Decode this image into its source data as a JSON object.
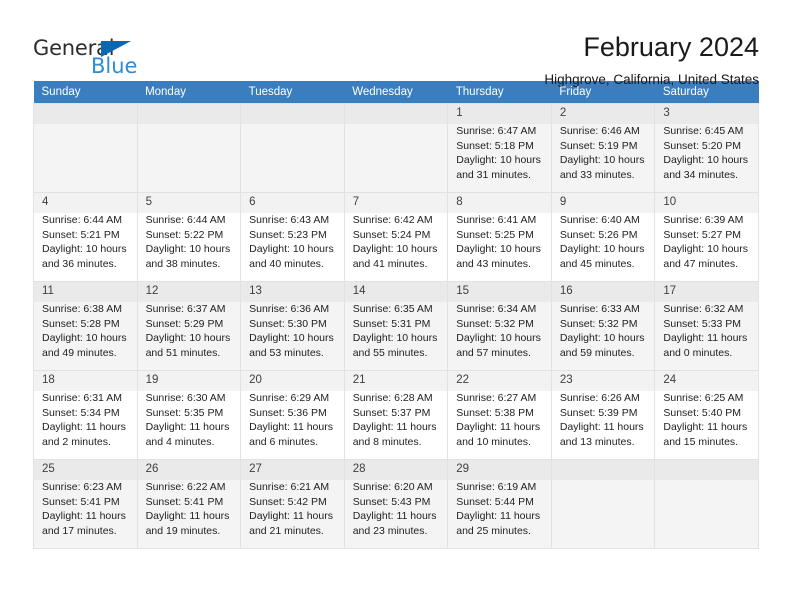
{
  "brand": {
    "name_top": "General",
    "name_bottom": "Blue",
    "triangle_color": "#0b67b2",
    "blue_text_color": "#2e8bd8"
  },
  "header": {
    "month_title": "February 2024",
    "location": "Highgrove, California, United States"
  },
  "calendar": {
    "header_background": "#3a7ebf",
    "weekdays": [
      "Sunday",
      "Monday",
      "Tuesday",
      "Wednesday",
      "Thursday",
      "Friday",
      "Saturday"
    ],
    "weeks": [
      [
        {
          "day": "",
          "sunrise": "",
          "sunset": "",
          "daylight": ""
        },
        {
          "day": "",
          "sunrise": "",
          "sunset": "",
          "daylight": ""
        },
        {
          "day": "",
          "sunrise": "",
          "sunset": "",
          "daylight": ""
        },
        {
          "day": "",
          "sunrise": "",
          "sunset": "",
          "daylight": ""
        },
        {
          "day": "1",
          "sunrise": "Sunrise: 6:47 AM",
          "sunset": "Sunset: 5:18 PM",
          "daylight": "Daylight: 10 hours and 31 minutes."
        },
        {
          "day": "2",
          "sunrise": "Sunrise: 6:46 AM",
          "sunset": "Sunset: 5:19 PM",
          "daylight": "Daylight: 10 hours and 33 minutes."
        },
        {
          "day": "3",
          "sunrise": "Sunrise: 6:45 AM",
          "sunset": "Sunset: 5:20 PM",
          "daylight": "Daylight: 10 hours and 34 minutes."
        }
      ],
      [
        {
          "day": "4",
          "sunrise": "Sunrise: 6:44 AM",
          "sunset": "Sunset: 5:21 PM",
          "daylight": "Daylight: 10 hours and 36 minutes."
        },
        {
          "day": "5",
          "sunrise": "Sunrise: 6:44 AM",
          "sunset": "Sunset: 5:22 PM",
          "daylight": "Daylight: 10 hours and 38 minutes."
        },
        {
          "day": "6",
          "sunrise": "Sunrise: 6:43 AM",
          "sunset": "Sunset: 5:23 PM",
          "daylight": "Daylight: 10 hours and 40 minutes."
        },
        {
          "day": "7",
          "sunrise": "Sunrise: 6:42 AM",
          "sunset": "Sunset: 5:24 PM",
          "daylight": "Daylight: 10 hours and 41 minutes."
        },
        {
          "day": "8",
          "sunrise": "Sunrise: 6:41 AM",
          "sunset": "Sunset: 5:25 PM",
          "daylight": "Daylight: 10 hours and 43 minutes."
        },
        {
          "day": "9",
          "sunrise": "Sunrise: 6:40 AM",
          "sunset": "Sunset: 5:26 PM",
          "daylight": "Daylight: 10 hours and 45 minutes."
        },
        {
          "day": "10",
          "sunrise": "Sunrise: 6:39 AM",
          "sunset": "Sunset: 5:27 PM",
          "daylight": "Daylight: 10 hours and 47 minutes."
        }
      ],
      [
        {
          "day": "11",
          "sunrise": "Sunrise: 6:38 AM",
          "sunset": "Sunset: 5:28 PM",
          "daylight": "Daylight: 10 hours and 49 minutes."
        },
        {
          "day": "12",
          "sunrise": "Sunrise: 6:37 AM",
          "sunset": "Sunset: 5:29 PM",
          "daylight": "Daylight: 10 hours and 51 minutes."
        },
        {
          "day": "13",
          "sunrise": "Sunrise: 6:36 AM",
          "sunset": "Sunset: 5:30 PM",
          "daylight": "Daylight: 10 hours and 53 minutes."
        },
        {
          "day": "14",
          "sunrise": "Sunrise: 6:35 AM",
          "sunset": "Sunset: 5:31 PM",
          "daylight": "Daylight: 10 hours and 55 minutes."
        },
        {
          "day": "15",
          "sunrise": "Sunrise: 6:34 AM",
          "sunset": "Sunset: 5:32 PM",
          "daylight": "Daylight: 10 hours and 57 minutes."
        },
        {
          "day": "16",
          "sunrise": "Sunrise: 6:33 AM",
          "sunset": "Sunset: 5:32 PM",
          "daylight": "Daylight: 10 hours and 59 minutes."
        },
        {
          "day": "17",
          "sunrise": "Sunrise: 6:32 AM",
          "sunset": "Sunset: 5:33 PM",
          "daylight": "Daylight: 11 hours and 0 minutes."
        }
      ],
      [
        {
          "day": "18",
          "sunrise": "Sunrise: 6:31 AM",
          "sunset": "Sunset: 5:34 PM",
          "daylight": "Daylight: 11 hours and 2 minutes."
        },
        {
          "day": "19",
          "sunrise": "Sunrise: 6:30 AM",
          "sunset": "Sunset: 5:35 PM",
          "daylight": "Daylight: 11 hours and 4 minutes."
        },
        {
          "day": "20",
          "sunrise": "Sunrise: 6:29 AM",
          "sunset": "Sunset: 5:36 PM",
          "daylight": "Daylight: 11 hours and 6 minutes."
        },
        {
          "day": "21",
          "sunrise": "Sunrise: 6:28 AM",
          "sunset": "Sunset: 5:37 PM",
          "daylight": "Daylight: 11 hours and 8 minutes."
        },
        {
          "day": "22",
          "sunrise": "Sunrise: 6:27 AM",
          "sunset": "Sunset: 5:38 PM",
          "daylight": "Daylight: 11 hours and 10 minutes."
        },
        {
          "day": "23",
          "sunrise": "Sunrise: 6:26 AM",
          "sunset": "Sunset: 5:39 PM",
          "daylight": "Daylight: 11 hours and 13 minutes."
        },
        {
          "day": "24",
          "sunrise": "Sunrise: 6:25 AM",
          "sunset": "Sunset: 5:40 PM",
          "daylight": "Daylight: 11 hours and 15 minutes."
        }
      ],
      [
        {
          "day": "25",
          "sunrise": "Sunrise: 6:23 AM",
          "sunset": "Sunset: 5:41 PM",
          "daylight": "Daylight: 11 hours and 17 minutes."
        },
        {
          "day": "26",
          "sunrise": "Sunrise: 6:22 AM",
          "sunset": "Sunset: 5:41 PM",
          "daylight": "Daylight: 11 hours and 19 minutes."
        },
        {
          "day": "27",
          "sunrise": "Sunrise: 6:21 AM",
          "sunset": "Sunset: 5:42 PM",
          "daylight": "Daylight: 11 hours and 21 minutes."
        },
        {
          "day": "28",
          "sunrise": "Sunrise: 6:20 AM",
          "sunset": "Sunset: 5:43 PM",
          "daylight": "Daylight: 11 hours and 23 minutes."
        },
        {
          "day": "29",
          "sunrise": "Sunrise: 6:19 AM",
          "sunset": "Sunset: 5:44 PM",
          "daylight": "Daylight: 11 hours and 25 minutes."
        },
        {
          "day": "",
          "sunrise": "",
          "sunset": "",
          "daylight": ""
        },
        {
          "day": "",
          "sunrise": "",
          "sunset": "",
          "daylight": ""
        }
      ]
    ]
  }
}
